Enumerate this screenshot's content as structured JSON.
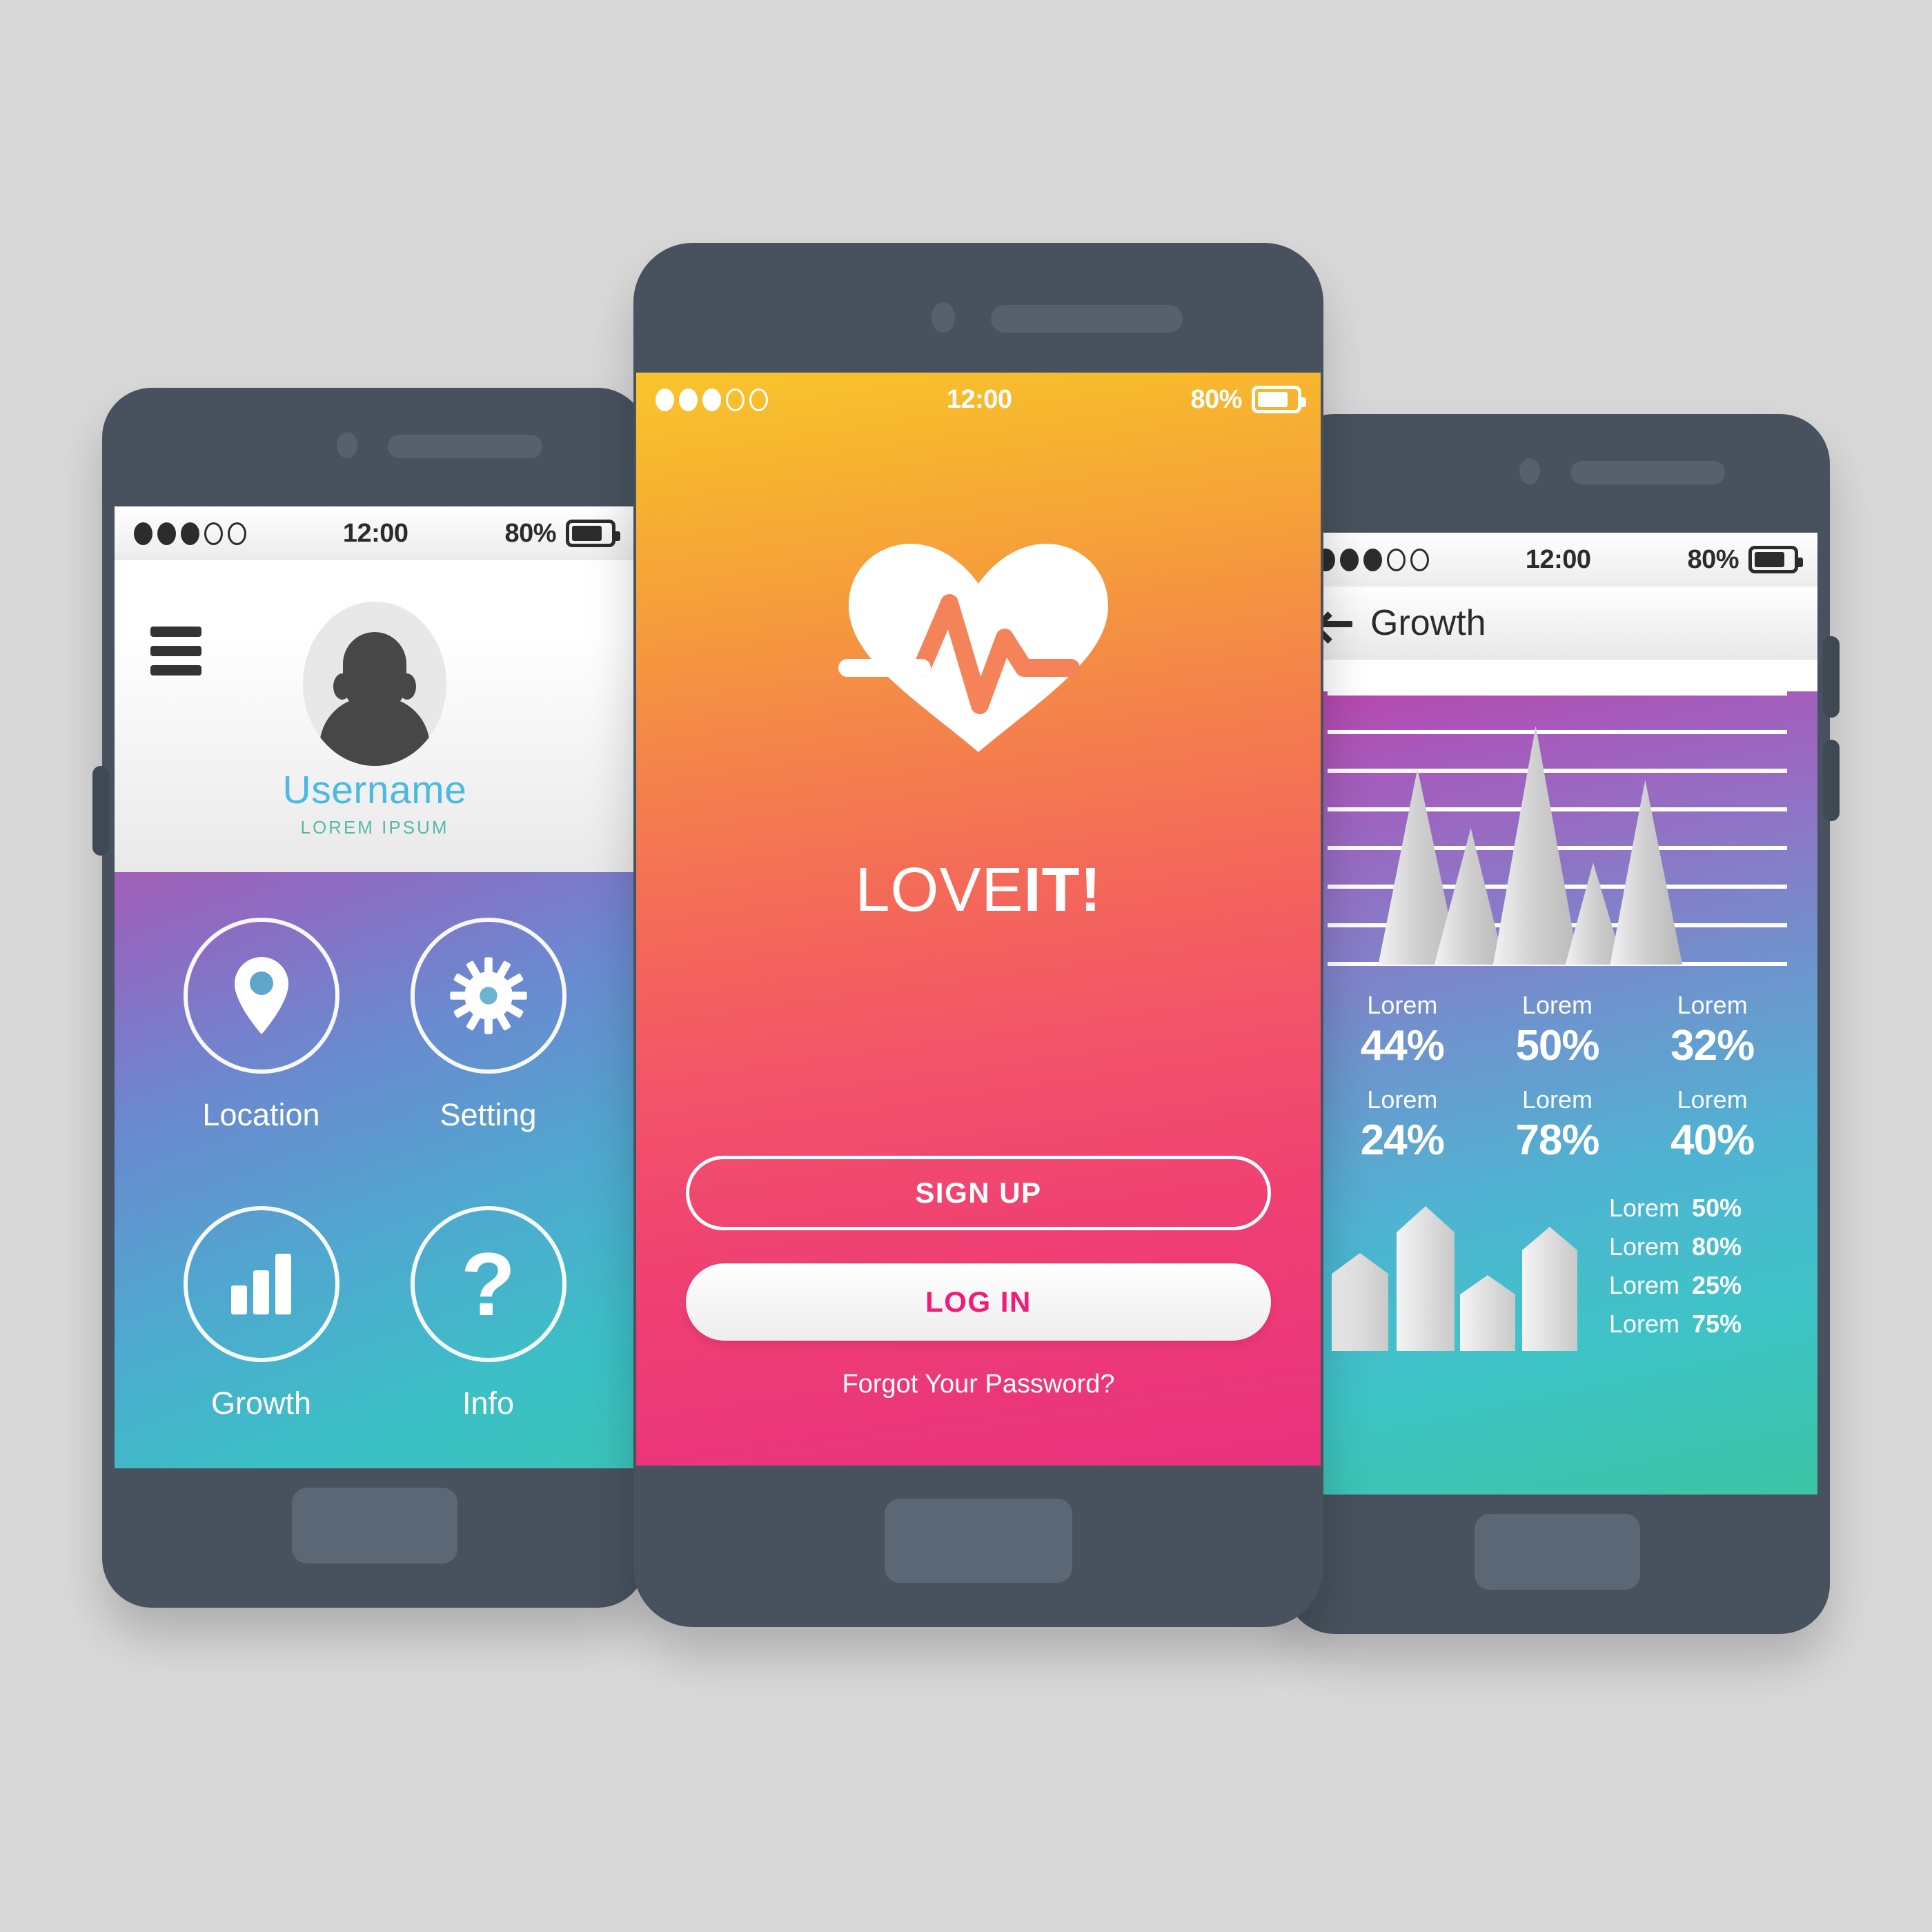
{
  "theme": {
    "page_background": "#d9d9d9",
    "device_body": "#47525e",
    "accent_pink": "#ef1c7a",
    "accent_blue": "#4cb9e0",
    "accent_teal": "#55b9a8"
  },
  "phone_left": {
    "statusbar": {
      "time": "12:00",
      "battery_percent": "80%",
      "signal_dots": [
        "on",
        "on",
        "on",
        "off",
        "off"
      ]
    },
    "profile": {
      "username": "Username",
      "subtitle": "LOREM IPSUM",
      "avatar_icon": "user-avatar-icon",
      "menu_icon": "hamburger-menu-icon"
    },
    "tiles": [
      {
        "icon": "location-pin-icon",
        "label": "Location"
      },
      {
        "icon": "gear-icon",
        "label": "Setting"
      },
      {
        "icon": "bar-chart-icon",
        "label": "Growth"
      },
      {
        "icon": "question-mark-icon",
        "label": "Info"
      }
    ]
  },
  "phone_center": {
    "statusbar": {
      "time": "12:00",
      "battery_percent": "80%",
      "signal_dots": [
        "on",
        "on",
        "on",
        "off",
        "off"
      ]
    },
    "logo_icon": "heart-pulse-icon",
    "brand": {
      "part_thin": "LOVE",
      "part_bold": "IT!"
    },
    "signup_label": "SIGN UP",
    "login_label": "LOG IN",
    "forgot_label": "Forgot Your Password?"
  },
  "phone_right": {
    "statusbar": {
      "time": "12:00",
      "battery_percent": "80%",
      "signal_dots": [
        "on",
        "on",
        "off",
        "off"
      ]
    },
    "nav": {
      "back_icon": "back-arrow-icon",
      "title": "Growth"
    },
    "stats": [
      {
        "label": "Lorem",
        "value": "44%"
      },
      {
        "label": "Lorem",
        "value": "50%"
      },
      {
        "label": "Lorem",
        "value": "32%"
      },
      {
        "label": "Lorem",
        "value": "24%"
      },
      {
        "label": "Lorem",
        "value": "78%"
      },
      {
        "label": "Lorem",
        "value": "40%"
      }
    ],
    "legend": [
      {
        "label": "Lorem",
        "value": "50%"
      },
      {
        "label": "Lorem",
        "value": "80%"
      },
      {
        "label": "Lorem",
        "value": "25%"
      },
      {
        "label": "Lorem",
        "value": "75%"
      }
    ]
  },
  "chart_data": [
    {
      "type": "area",
      "name": "mountain-peaks-chart",
      "title": "Growth",
      "categories": [
        "1",
        "2",
        "3",
        "4",
        "5"
      ],
      "values": [
        72,
        55,
        100,
        32,
        65
      ],
      "ylim": [
        0,
        100
      ],
      "gridlines": 8,
      "grid": true,
      "legend_position": "none",
      "xlabel": "",
      "ylabel": ""
    },
    {
      "type": "bar",
      "name": "column-chart",
      "categories": [
        "Lorem",
        "Lorem",
        "Lorem",
        "Lorem"
      ],
      "values": [
        50,
        80,
        25,
        75
      ],
      "ylim": [
        0,
        100
      ],
      "grid": false,
      "legend_position": "right",
      "xlabel": "",
      "ylabel": ""
    },
    {
      "type": "table",
      "name": "percentage-stats-grid",
      "categories": [
        "Lorem",
        "Lorem",
        "Lorem",
        "Lorem",
        "Lorem",
        "Lorem"
      ],
      "values": [
        44,
        50,
        32,
        24,
        78,
        40
      ],
      "title": "",
      "ylim": [
        0,
        100
      ]
    }
  ]
}
